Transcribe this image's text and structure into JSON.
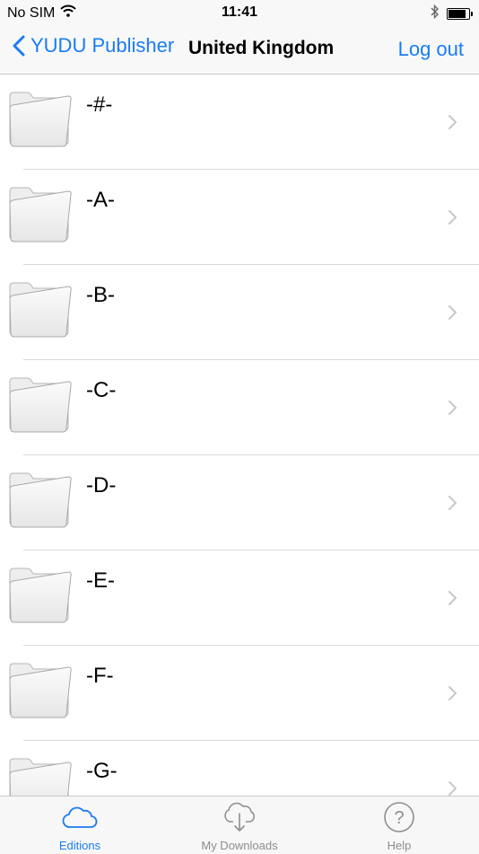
{
  "status_bar": {
    "carrier": "No SIM",
    "time": "11:41"
  },
  "nav": {
    "back_label": "YUDU Publisher",
    "title": "United Kingdom",
    "right_label": "Log out"
  },
  "list": {
    "items": [
      {
        "label": "-#-"
      },
      {
        "label": "-A-"
      },
      {
        "label": "-B-"
      },
      {
        "label": "-C-"
      },
      {
        "label": "-D-"
      },
      {
        "label": "-E-"
      },
      {
        "label": "-F-"
      },
      {
        "label": "-G-"
      }
    ]
  },
  "tabs": [
    {
      "label": "Editions",
      "icon": "cloud-icon",
      "active": true
    },
    {
      "label": "My Downloads",
      "icon": "cloud-download-icon",
      "active": false
    },
    {
      "label": "Help",
      "icon": "question-icon",
      "active": false
    }
  ],
  "colors": {
    "accent": "#1a7cf2",
    "inactive": "#8e8e93"
  }
}
